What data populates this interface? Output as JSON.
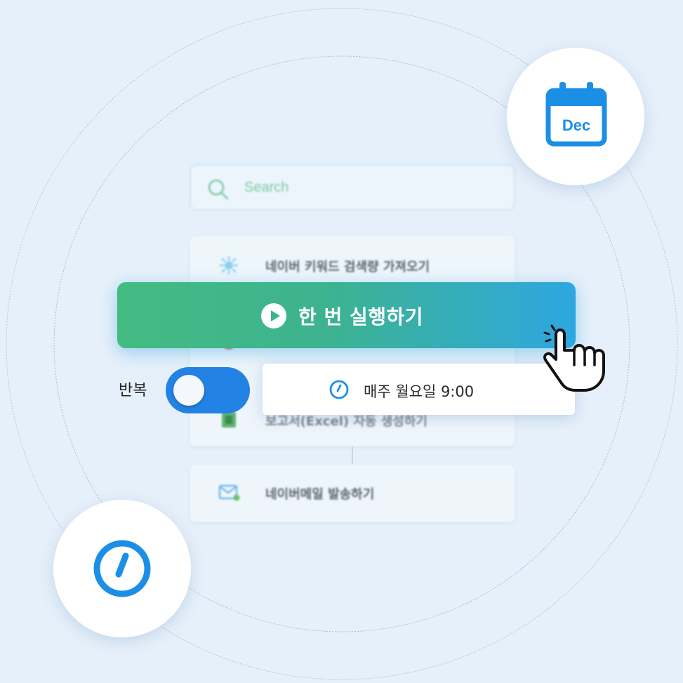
{
  "search": {
    "placeholder": "Search"
  },
  "tasks": [
    {
      "label": "네이버 키워드 검색량 가져오기",
      "icon": "gear-bug-icon"
    },
    {
      "label": "",
      "icon": "red-dot-icon"
    },
    {
      "label": "보고서(Excel) 자동 생성하기",
      "icon": "excel-icon"
    }
  ],
  "mail_task": {
    "label": "네이버메일 발송하기",
    "icon": "mail-icon"
  },
  "run_button": {
    "label": "한 번 실행하기"
  },
  "repeat": {
    "label": "반복",
    "enabled": true
  },
  "schedule": {
    "text": "매주 월요일 9:00"
  },
  "calendar": {
    "month": "Dec"
  },
  "colors": {
    "accent_blue": "#1b8fe6",
    "button_green": "#43bb82",
    "button_blue": "#2da7e0",
    "toggle_blue": "#2383e5"
  }
}
